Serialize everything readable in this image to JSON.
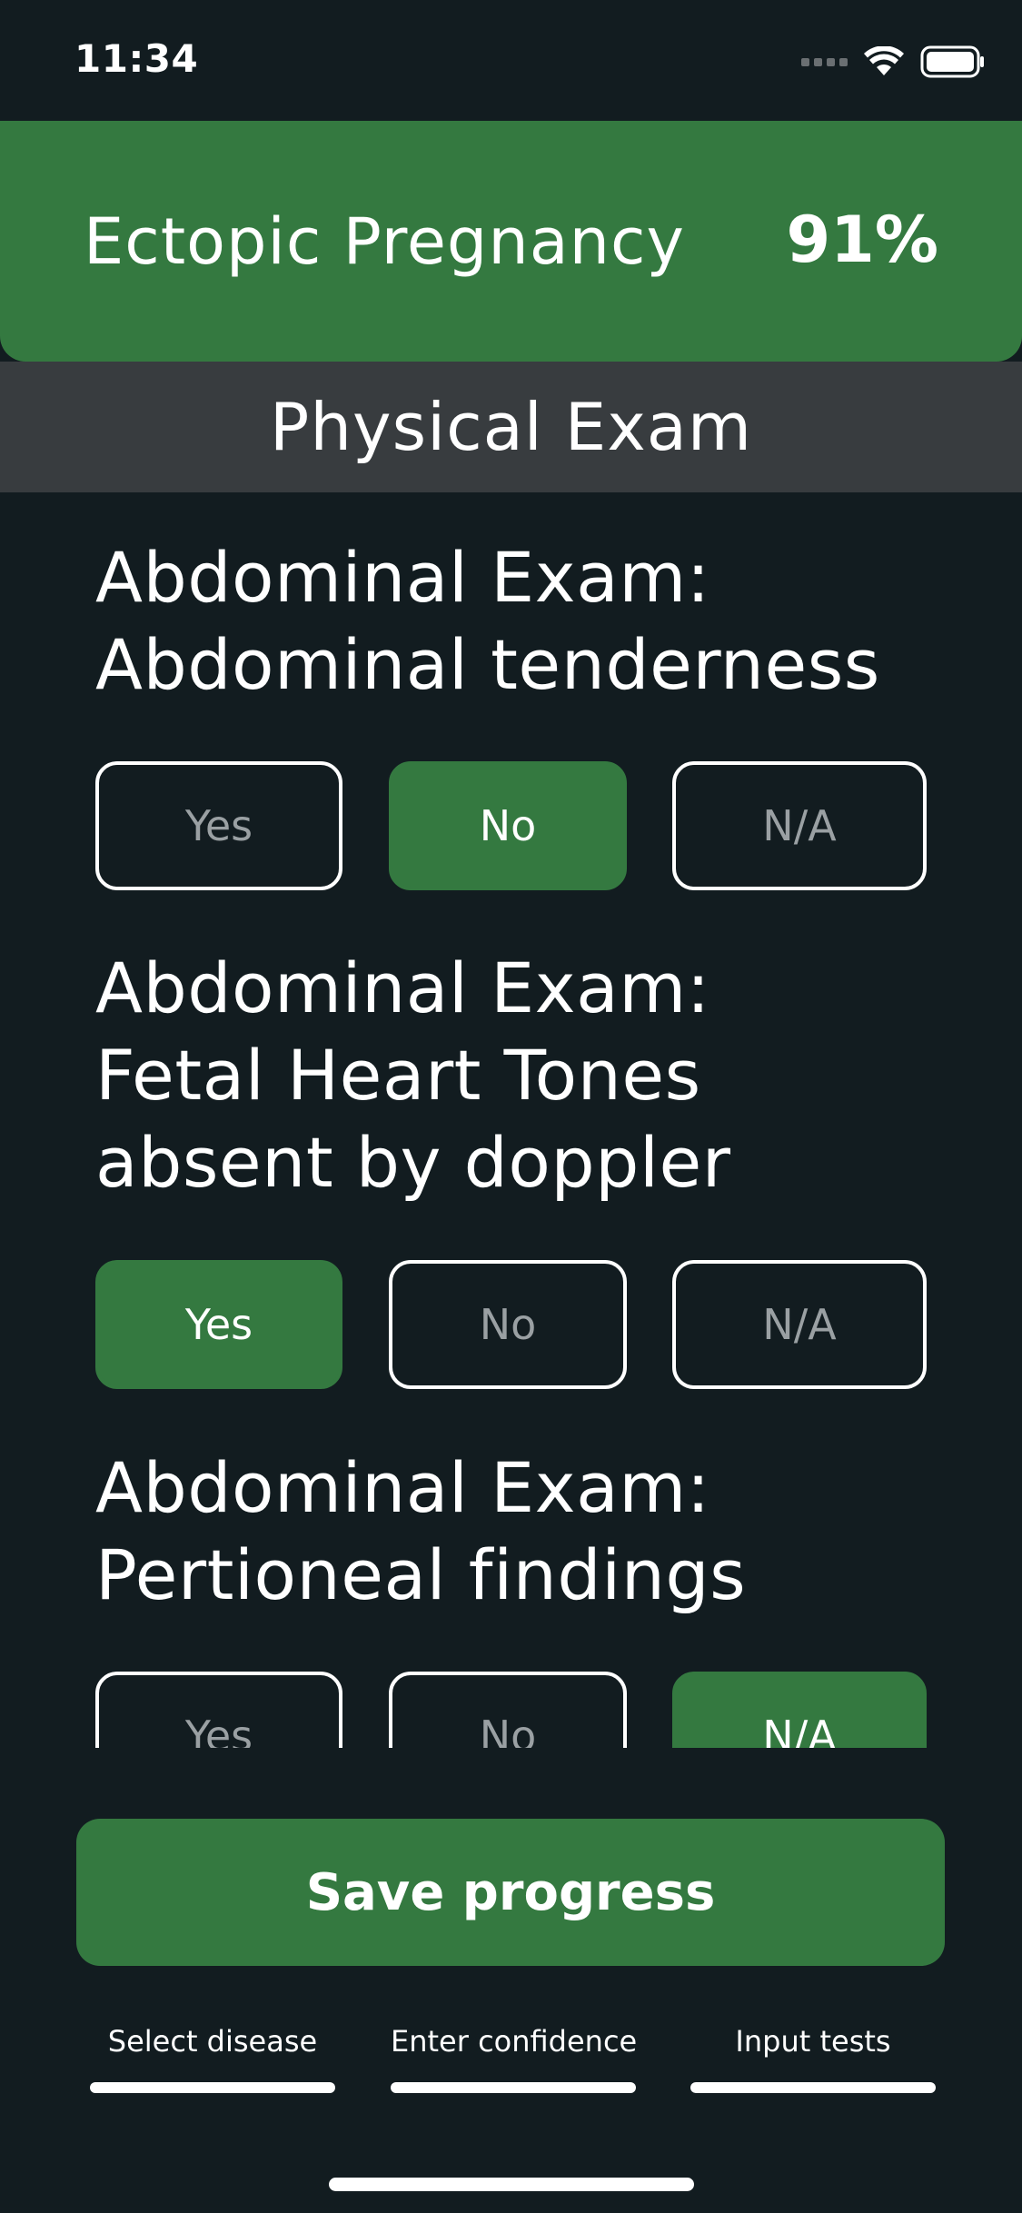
{
  "status_bar": {
    "time": "11:34"
  },
  "header": {
    "disease": "Ectopic Pregnancy",
    "confidence": "91%"
  },
  "section": {
    "title": "Physical Exam"
  },
  "questions": [
    {
      "line1": "Abdominal Exam:",
      "line2": "Abdominal tenderness",
      "line3": "",
      "options": [
        "Yes",
        "No",
        "N/A"
      ],
      "selected": "No"
    },
    {
      "line1": "Abdominal Exam:",
      "line2": "Fetal Heart Tones",
      "line3": "absent by doppler",
      "options": [
        "Yes",
        "No",
        "N/A"
      ],
      "selected": "Yes"
    },
    {
      "line1": "Abdominal Exam:",
      "line2": "Pertioneal findings",
      "line3": "",
      "options": [
        "Yes",
        "No",
        "N/A"
      ],
      "selected": "N/A"
    }
  ],
  "save_button": {
    "label": "Save progress"
  },
  "steps": [
    {
      "label": "Select disease"
    },
    {
      "label": "Enter confidence"
    },
    {
      "label": "Input tests"
    }
  ],
  "colors": {
    "background": "#121c20",
    "accent": "#347940",
    "section_bar": "#383c3f"
  }
}
